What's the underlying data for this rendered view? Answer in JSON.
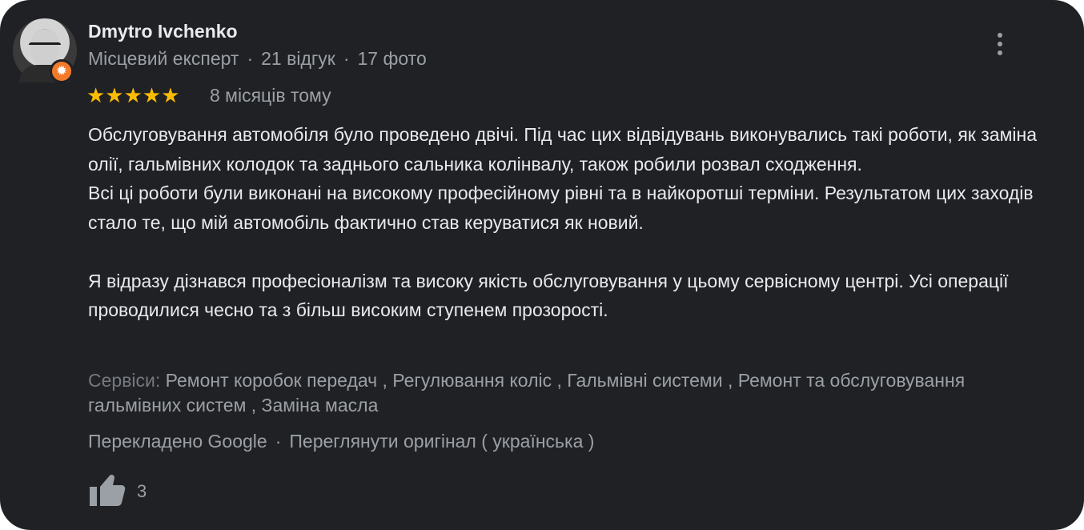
{
  "reviewer": {
    "name": "Dmytro Ivchenko",
    "role": "Місцевий експерт",
    "reviews": "21 відгук",
    "photos": "17 фото",
    "separator": "·"
  },
  "rating": {
    "stars": 5,
    "stars_text": "★★★★★",
    "time": "8 місяців тому"
  },
  "review": {
    "p1": "Обслуговування автомобіля було проведено двічі. Під час цих відвідувань виконувались такі роботи, як заміна олії, гальмівних колодок та заднього сальника колінвалу, також робили розвал сходження.",
    "p2": "Всі ці роботи були виконані на високому професійному рівні та в найкоротші терміни. Результатом цих заходів стало те, що мій автомобіль фактично став керуватися як новий.",
    "p3": "Я відразу дізнався професіоналізм та високу якість обслуговування у цьому сервісному центрі. Усі операції проводилися чесно та з більш високим ступенем прозорості."
  },
  "services": {
    "label": "Сервіси:",
    "list": "Ремонт коробок передач ,  Регулювання коліс ,  Гальмівні системи ,  Ремонт та обслуговування гальмівних систем ,  Заміна масла"
  },
  "translation": {
    "note": "Перекладено Google",
    "separator": "·",
    "link": "Переглянути оригінал ( українська )"
  },
  "likes": {
    "count": "3"
  },
  "colors": {
    "background": "#202124",
    "text": "#e8eaed",
    "muted": "#9aa0a6",
    "star": "#fbbc04",
    "badge": "#f37a2b"
  },
  "icons": {
    "badge": "local-guide-badge-icon",
    "more": "more-vert-icon",
    "like": "thumbs-up-icon"
  }
}
